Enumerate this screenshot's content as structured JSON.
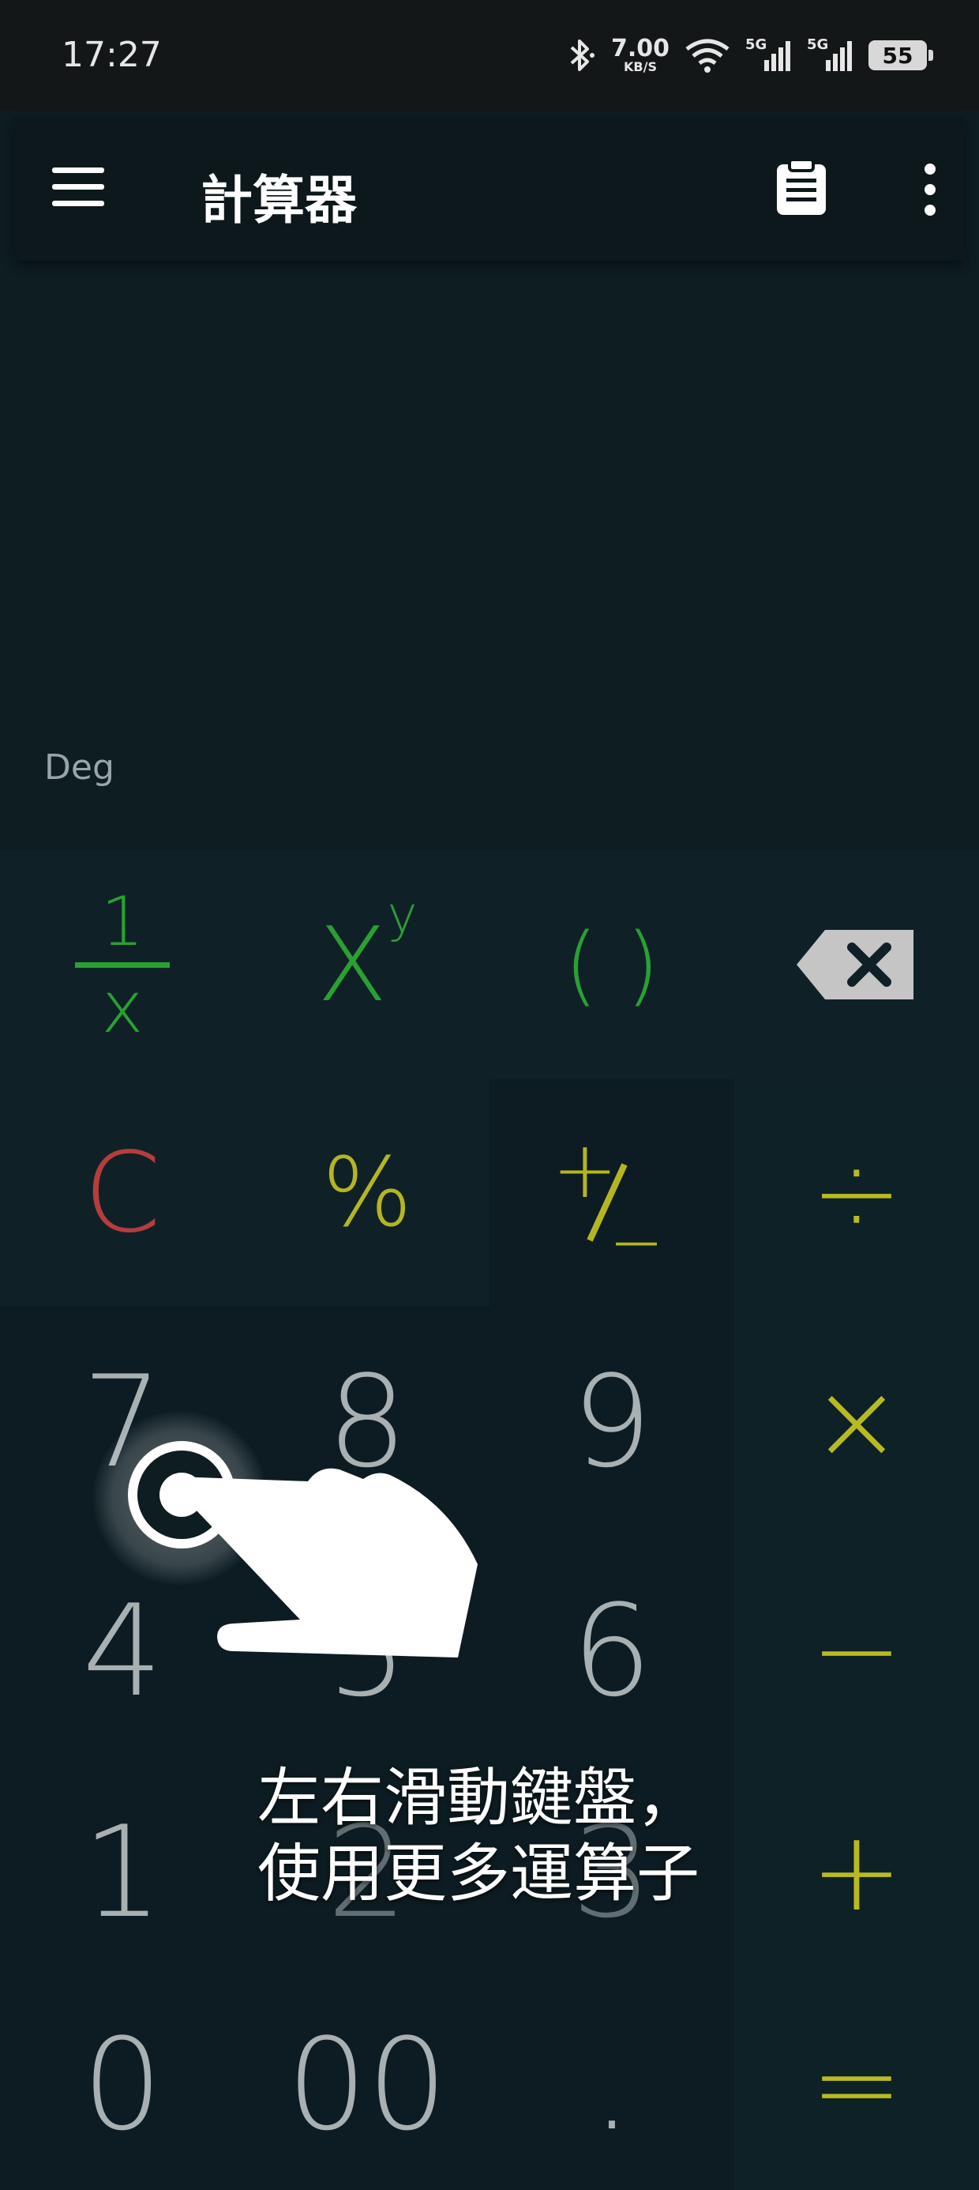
{
  "status_bar": {
    "time": "17:27",
    "net_speed_value": "7.00",
    "net_speed_unit": "KB/S",
    "signal1_label": "5G",
    "signal2_label": "5G",
    "battery": "55",
    "icons": [
      "bluetooth-icon",
      "wifi-icon",
      "signal-icon",
      "signal-icon",
      "battery-icon"
    ]
  },
  "app_bar": {
    "title": "計算器",
    "menu_icon": "menu-icon",
    "clipboard_icon": "clipboard-icon",
    "more_icon": "more-vert-icon"
  },
  "display": {
    "angle_mode": "Deg"
  },
  "keypad": {
    "reciprocal_num": "1",
    "reciprocal_den": "x",
    "power_base": "X",
    "power_exp": "y",
    "parens": "( )",
    "backspace_icon": "backspace-icon",
    "clear": "C",
    "percent": "%",
    "sign_plus": "+",
    "sign_minus": "_",
    "divide": "÷",
    "multiply": "×",
    "minus": "−",
    "plus": "+",
    "equals": "=",
    "digits": {
      "d7": "7",
      "d8": "8",
      "d9": "9",
      "d4": "4",
      "d5": "5",
      "d6": "6",
      "d1": "1",
      "d2": "2",
      "d3": "3",
      "d0": "0",
      "d00": "00",
      "dot": "."
    }
  },
  "hint": {
    "line1": "左右滑動鍵盤，",
    "line2": "使用更多運算子",
    "gesture_icon": "swipe-hand-icon"
  },
  "colors": {
    "background": "#0e1d22",
    "green_func": "#2aa034",
    "yellow_op": "#b5b521",
    "red_clear": "#b53d3d",
    "digit_gray": "#a8b0b2"
  }
}
